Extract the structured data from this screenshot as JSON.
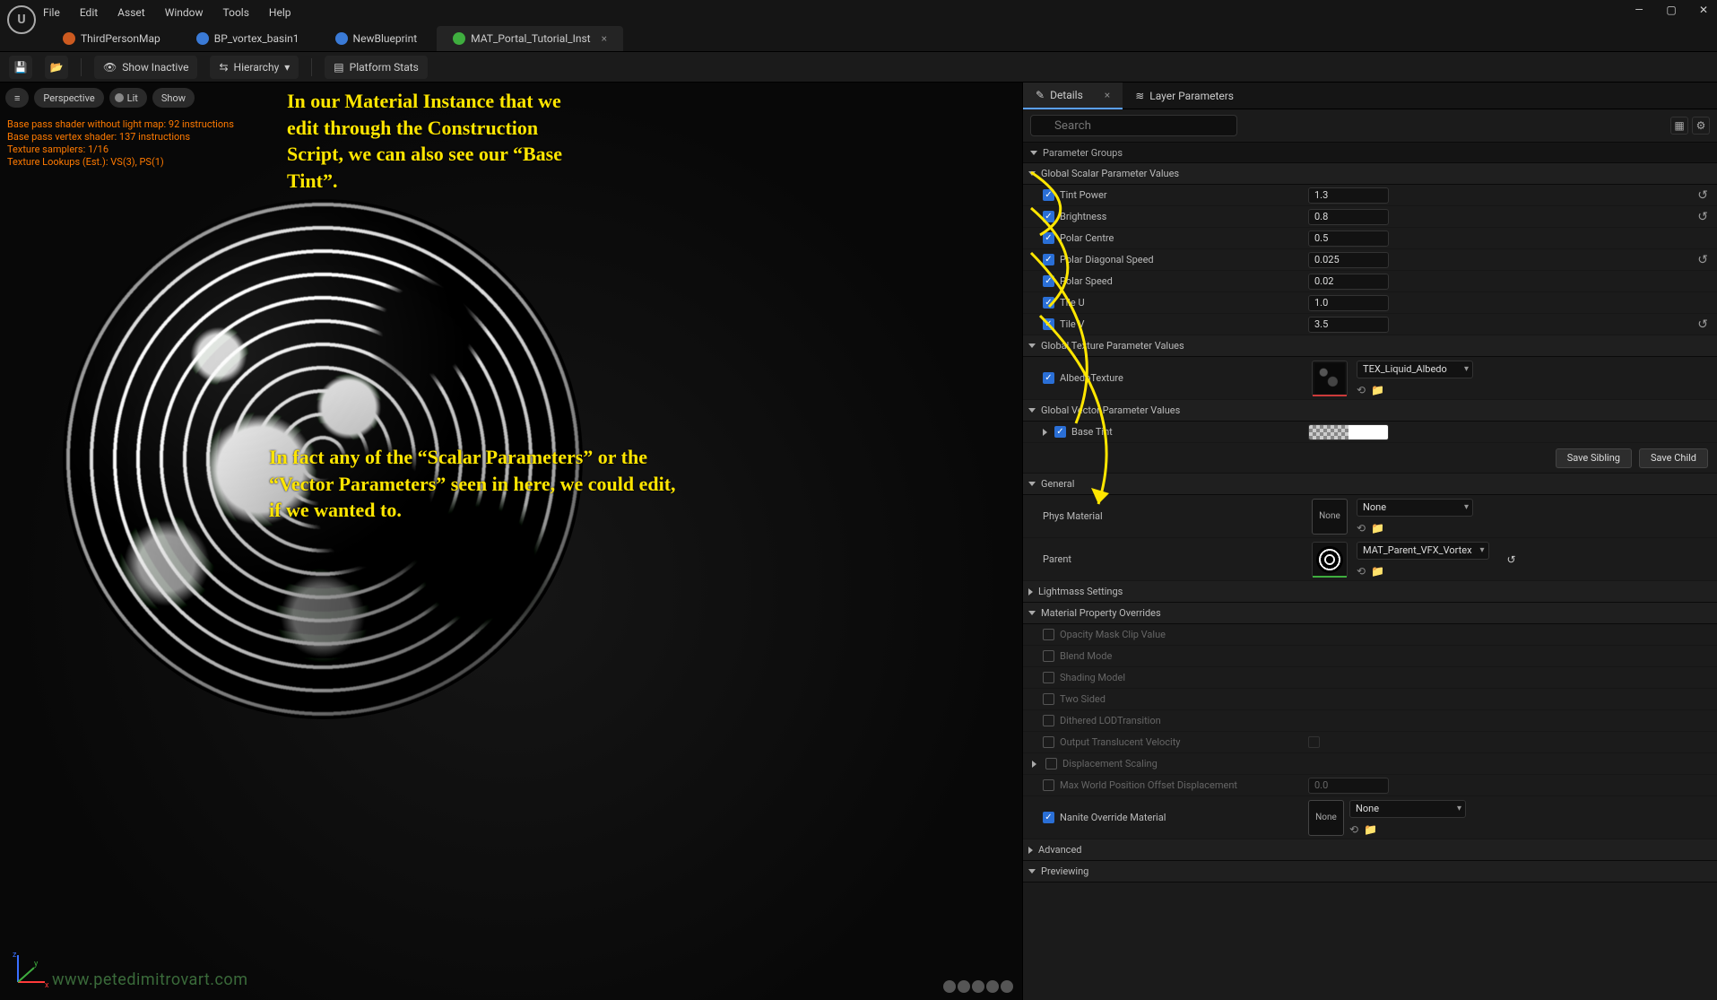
{
  "menubar": {
    "items": [
      "File",
      "Edit",
      "Asset",
      "Window",
      "Tools",
      "Help"
    ]
  },
  "window_buttons": {
    "min": "—",
    "max": "▢",
    "close": "✕"
  },
  "tabs": [
    {
      "label": "ThirdPersonMap",
      "icon_color": "#cc5a20",
      "active": false
    },
    {
      "label": "BP_vortex_basin1",
      "icon_color": "#3a7ad6",
      "active": false
    },
    {
      "label": "NewBlueprint",
      "icon_color": "#3a7ad6",
      "active": false
    },
    {
      "label": "MAT_Portal_Tutorial_Inst",
      "icon_color": "#3fae3f",
      "active": true
    }
  ],
  "toolbar": {
    "save_icon": "💾",
    "browse_icon": "📂",
    "show_inactive": "Show Inactive",
    "hierarchy": "Hierarchy",
    "platform_stats": "Platform Stats"
  },
  "viewport": {
    "menu_icon": "≡",
    "perspective": "Perspective",
    "lit": "Lit",
    "show": "Show",
    "stats": [
      "Base pass shader without light map: 92 instructions",
      "Base pass vertex shader: 137 instructions",
      "Texture samplers: 1/16",
      "Texture Lookups (Est.): VS(3), PS(1)"
    ],
    "watermark": "www.petedimitrovart.com"
  },
  "annotations": {
    "top": "In our Material Instance that we edit through the Construction Script, we can also see our “Base Tint”.",
    "bottom": "In fact any of the “Scalar Parameters” or the “Vector Parameters” seen in here, we could edit, if we wanted to."
  },
  "details": {
    "tab_details": "Details",
    "tab_layers": "Layer Parameters",
    "search_placeholder": "Search",
    "param_groups_hdr": "Parameter Groups",
    "scalar_hdr": "Global Scalar Parameter Values",
    "texture_hdr": "Global Texture Parameter Values",
    "vector_hdr": "Global Vector Parameter Values",
    "general_hdr": "General",
    "lightmass_hdr": "Lightmass Settings",
    "overrides_hdr": "Material Property Overrides",
    "advanced_hdr": "Advanced",
    "previewing_hdr": "Previewing",
    "scalars": [
      {
        "name": "Tint Power",
        "value": "1.3",
        "checked": true,
        "reset": true
      },
      {
        "name": "Brightness",
        "value": "0.8",
        "checked": true,
        "reset": true
      },
      {
        "name": "Polar Centre",
        "value": "0.5",
        "checked": true,
        "reset": false
      },
      {
        "name": "Polar Diagonal Speed",
        "value": "0.025",
        "checked": true,
        "reset": true
      },
      {
        "name": "Polar Speed",
        "value": "0.02",
        "checked": true,
        "reset": false
      },
      {
        "name": "Tile U",
        "value": "1.0",
        "checked": true,
        "reset": false
      },
      {
        "name": "Tile V",
        "value": "3.5",
        "checked": true,
        "reset": true
      }
    ],
    "texture": {
      "name": "AlbedoTexture",
      "asset": "TEX_Liquid_Albedo",
      "checked": true
    },
    "vector": {
      "name": "Base Tint",
      "checked": true
    },
    "save_sibling": "Save Sibling",
    "save_child": "Save Child",
    "phys": {
      "label": "Phys Material",
      "value": "None"
    },
    "parent": {
      "label": "Parent",
      "value": "MAT_Parent_VFX_Vortex"
    },
    "overrides": [
      "Opacity Mask Clip Value",
      "Blend Mode",
      "Shading Model",
      "Two Sided",
      "Dithered LODTransition",
      "Output Translucent Velocity",
      "Displacement Scaling",
      "Max World Position Offset Displacement"
    ],
    "max_wpo_val": "0.0",
    "nanite": {
      "label": "Nanite Override Material",
      "value": "None",
      "checked": true
    },
    "none": "None"
  }
}
